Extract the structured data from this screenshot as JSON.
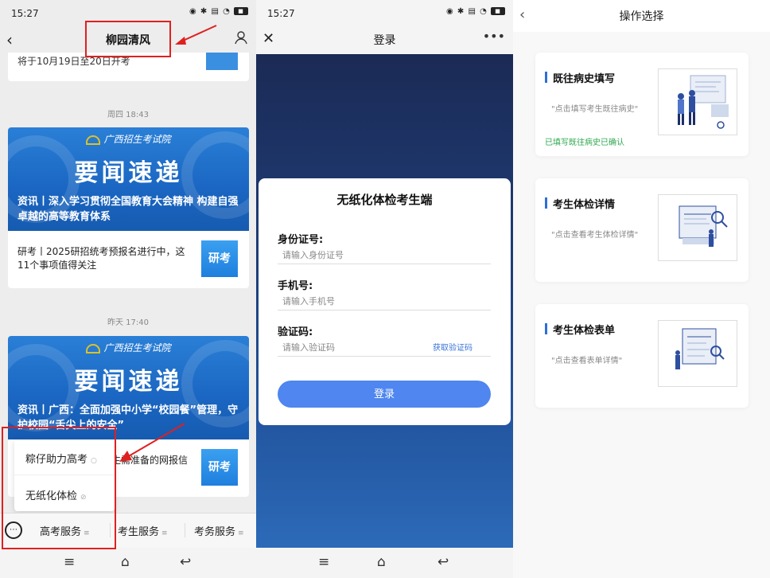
{
  "panel1": {
    "status": {
      "time": "15:27",
      "icons": "⚙ ✶ ▥ ◉"
    },
    "title": "柳园清风",
    "top_card_text": "将于10月19日至20日开考",
    "timestamp1": "周四 18:43",
    "timestamp2": "昨天 17:40",
    "banner_logo": "广西招生考试院",
    "banner_headline": "要闻速递",
    "news1": {
      "banner_sub": "资讯丨深入学习贯彻全国教育大会精神 构建自强卓越的高等教育体系",
      "item_text": "研考丨2025研招统考预报名进行中，这11个事项值得关注",
      "tag": "研考"
    },
    "news2": {
      "banner_sub": "资讯丨广西：全面加强中小学“校园餐”管理，守护校园“舌尖上的安全”",
      "item_text": "生需准备的网报信",
      "tag": "研考"
    },
    "popup": {
      "item1": "粽仔助力高考",
      "item2": "无纸化体检"
    },
    "menu": {
      "m1": "高考服务",
      "m2": "考生服务",
      "m3": "考务服务"
    }
  },
  "panel2": {
    "status": {
      "time": "15:27"
    },
    "title": "登录",
    "card_title": "无纸化体检考生端",
    "id_label": "身份证号:",
    "id_placeholder": "请输入身份证号",
    "phone_label": "手机号:",
    "phone_placeholder": "请输入手机号",
    "code_label": "验证码:",
    "code_placeholder": "请输入验证码",
    "get_code": "获取验证码",
    "login_button": "登录"
  },
  "panel3": {
    "title": "操作选择",
    "cards": [
      {
        "title": "既往病史填写",
        "desc": "\"点击填写考生既往病史\"",
        "status": "已填写既往病史已确认"
      },
      {
        "title": "考生体检详情",
        "desc": "\"点击查看考生体检详情\""
      },
      {
        "title": "考生体检表单",
        "desc": "\"点击查看表单详情\""
      }
    ]
  },
  "colors": {
    "accent_blue": "#4f86ef",
    "annotation_red": "#e02020",
    "success_green": "#2fa84f"
  }
}
